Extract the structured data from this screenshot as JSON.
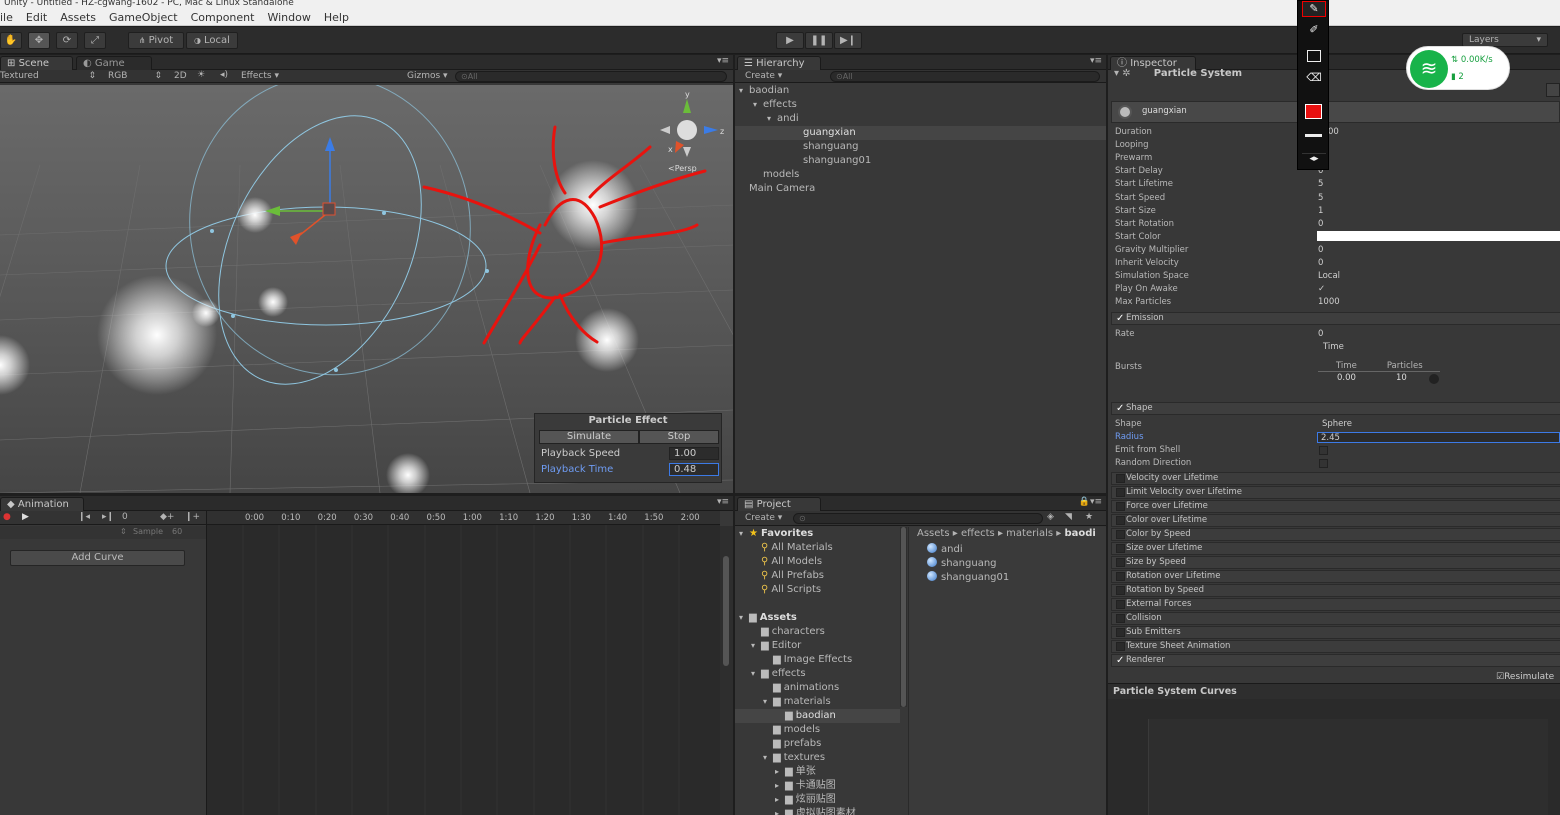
{
  "window": {
    "title": "Unity - Untitled - HZ-cgwang-1602 - PC, Mac & Linux Standalone"
  },
  "menu": [
    "ile",
    "Edit",
    "Assets",
    "GameObject",
    "Component",
    "Window",
    "Help"
  ],
  "toolbar": {
    "pivot": "Pivot",
    "local": "Local",
    "layers": "Layers"
  },
  "net_widget": {
    "speed": "0.00K/s",
    "count": "2"
  },
  "scene": {
    "tab_scene": "Scene",
    "tab_game": "Game",
    "shading": "Textured",
    "render_mode": "RGB",
    "mode_2d": "2D",
    "effects": "Effects",
    "gizmos": "Gizmos",
    "search": "All",
    "persp": "Persp",
    "axis_x": "x",
    "axis_y": "y",
    "axis_z": "z",
    "particle_effect": {
      "title": "Particle Effect",
      "simulate": "Simulate",
      "stop": "Stop",
      "playback_speed_label": "Playback Speed",
      "playback_speed": "1.00",
      "playback_time_label": "Playback Time",
      "playback_time": "0.48"
    }
  },
  "hierarchy": {
    "tab": "Hierarchy",
    "create": "Create",
    "search": "All",
    "items": [
      {
        "label": "baodian",
        "depth": 0,
        "expand": true
      },
      {
        "label": "effects",
        "depth": 1,
        "expand": true
      },
      {
        "label": "andi",
        "depth": 2,
        "expand": true
      },
      {
        "label": "guangxian",
        "depth": 3,
        "selected": true
      },
      {
        "label": "shanguang",
        "depth": 3
      },
      {
        "label": "shanguang01",
        "depth": 3
      },
      {
        "label": "models",
        "depth": 1
      },
      {
        "label": "Main Camera",
        "depth": 0
      }
    ]
  },
  "inspector": {
    "tab": "Inspector",
    "component": "Particle System",
    "system_name": "guangxian",
    "props": [
      {
        "label": "Duration",
        "value": "00"
      },
      {
        "label": "Looping",
        "value": ""
      },
      {
        "label": "Prewarm",
        "value": ""
      },
      {
        "label": "Start Delay",
        "value": "0"
      },
      {
        "label": "Start Lifetime",
        "value": "5"
      },
      {
        "label": "Start Speed",
        "value": "5"
      },
      {
        "label": "Start Size",
        "value": "1"
      },
      {
        "label": "Start Rotation",
        "value": "0"
      },
      {
        "label": "Start Color",
        "value": ""
      },
      {
        "label": "Gravity Multiplier",
        "value": "0"
      },
      {
        "label": "Inherit Velocity",
        "value": "0"
      },
      {
        "label": "Simulation Space",
        "value": "Local"
      },
      {
        "label": "Play On Awake",
        "value": "✓"
      },
      {
        "label": "Max Particles",
        "value": "1000"
      }
    ],
    "emission": {
      "title": "Emission",
      "rate_label": "Rate",
      "rate": "0",
      "unit": "Time",
      "bursts_label": "Bursts",
      "col_time": "Time",
      "col_particles": "Particles",
      "burst_time": "0.00",
      "burst_particles": "10"
    },
    "shape": {
      "title": "Shape",
      "shape_label": "Shape",
      "shape": "Sphere",
      "radius_label": "Radius",
      "radius": "2.45",
      "emit_label": "Emit from Shell",
      "random_label": "Random Direction"
    },
    "modules": [
      "Velocity over Lifetime",
      "Limit Velocity over Lifetime",
      "Force over Lifetime",
      "Color over Lifetime",
      "Color by Speed",
      "Size over Lifetime",
      "Size by Speed",
      "Rotation over Lifetime",
      "Rotation by Speed",
      "External Forces",
      "Collision",
      "Sub Emitters",
      "Texture Sheet Animation"
    ],
    "renderer": "Renderer",
    "resimulate": "Resimulate",
    "curves_title": "Particle System Curves"
  },
  "animation": {
    "tab": "Animation",
    "frame": "0",
    "sample_label": "Sample",
    "sample": "60",
    "add_curve": "Add Curve",
    "ticks": [
      "0:00",
      "0:10",
      "0:20",
      "0:30",
      "0:40",
      "0:50",
      "1:00",
      "1:10",
      "1:20",
      "1:30",
      "1:40",
      "1:50",
      "2:00"
    ]
  },
  "project": {
    "tab": "Project",
    "create": "Create",
    "favorites_label": "Favorites",
    "favorites": [
      "All Materials",
      "All Models",
      "All Prefabs",
      "All Scripts"
    ],
    "assets_label": "Assets",
    "tree": [
      {
        "label": "characters",
        "depth": 1
      },
      {
        "label": "Editor",
        "depth": 1,
        "expand": true
      },
      {
        "label": "Image Effects",
        "depth": 2
      },
      {
        "label": "effects",
        "depth": 1,
        "expand": true
      },
      {
        "label": "animations",
        "depth": 2
      },
      {
        "label": "materials",
        "depth": 2,
        "expand": true
      },
      {
        "label": "baodian",
        "depth": 3,
        "selected": true
      },
      {
        "label": "models",
        "depth": 2
      },
      {
        "label": "prefabs",
        "depth": 2
      },
      {
        "label": "textures",
        "depth": 2,
        "expand": true
      },
      {
        "label": "单张",
        "depth": 3,
        "collapsed": true
      },
      {
        "label": "卡通贴图",
        "depth": 3,
        "collapsed": true
      },
      {
        "label": "炫丽贴图",
        "depth": 3,
        "collapsed": true
      },
      {
        "label": "虚拟贴图素材",
        "depth": 3,
        "collapsed": true
      }
    ],
    "breadcrumb": [
      "Assets",
      "effects",
      "materials",
      "baodi"
    ],
    "files": [
      "andi",
      "shanguang",
      "shanguang01"
    ]
  }
}
